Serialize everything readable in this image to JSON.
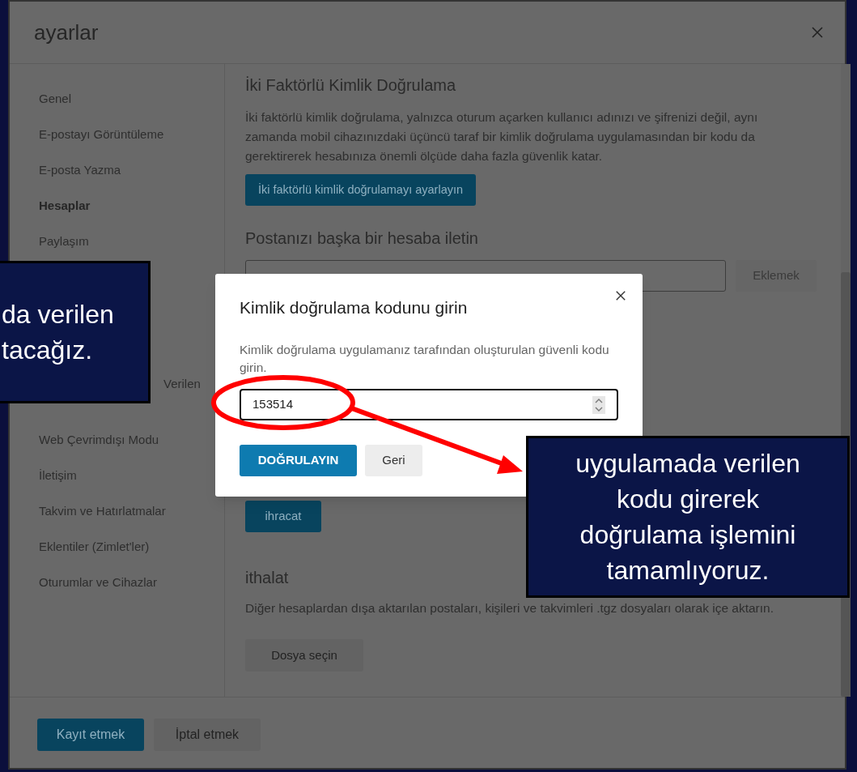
{
  "window": {
    "title": "ayarlar"
  },
  "sidebar": {
    "items": [
      {
        "label": "Genel",
        "selected": false
      },
      {
        "label": "E-postayı Görüntüleme",
        "selected": false
      },
      {
        "label": "E-posta Yazma",
        "selected": false
      },
      {
        "label": "Hesaplar",
        "selected": true
      },
      {
        "label": "Paylaşım",
        "selected": false
      }
    ],
    "more_items": [
      {
        "label": "Verilen",
        "selected": false,
        "kind": "cut"
      },
      {
        "label": "Web Çevrimdışı Modu",
        "selected": false,
        "kind": "full"
      },
      {
        "label": "İletişim",
        "selected": false,
        "kind": "full"
      },
      {
        "label": "Takvim ve Hatırlatmalar",
        "selected": false,
        "kind": "full"
      },
      {
        "label": "Eklentiler (Zimlet'ler)",
        "selected": false,
        "kind": "full"
      },
      {
        "label": "Oturumlar ve Cihazlar",
        "selected": false,
        "kind": "full"
      }
    ]
  },
  "two_factor": {
    "heading": "İki Faktörlü Kimlik Doğrulama",
    "text": "İki faktörlü kimlik doğrulama, yalnızca oturum açarken kullanıcı adınızı ve şifrenizi değil, aynı zamanda mobil cihazınızdaki üçüncü taraf bir kimlik doğrulama uygulamasından bir kodu da gerektirerek hesabınıza önemli ölçüde daha fazla güvenlik katar.",
    "button": "İki faktörlü kimlik doğrulamayı ayarlayın"
  },
  "forwarding": {
    "heading": "Postanızı başka bir hesaba iletin",
    "add_button": {
      "label": "Eklemek",
      "disabled": true
    }
  },
  "export": {
    "button": "ihracat"
  },
  "import": {
    "heading": "ithalat",
    "text": "Diğer hesaplardan dışa aktarılan postaları, kişileri ve takvimleri .tgz dosyaları olarak içe aktarın.",
    "button": "Dosya seçin"
  },
  "footer": {
    "buttons": [
      {
        "label": "Kayıt etmek",
        "kind": "primary"
      },
      {
        "label": "İptal etmek",
        "kind": "secondary"
      }
    ]
  },
  "dialog": {
    "title": "Kimlik doğrulama kodunu girin",
    "text": "Kimlik doğrulama uygulamanız tarafından oluşturulan güvenli kodu girin.",
    "field": {
      "value": "153514"
    },
    "buttons": [
      {
        "label": "DOĞRULAYIN",
        "kind": "primary"
      },
      {
        "label": "Geri",
        "kind": "secondary"
      }
    ]
  },
  "callouts": [
    {
      "lines": [
        "da verilen",
        "tacağız."
      ],
      "kind": "left"
    },
    {
      "lines": [
        "uygulamada verilen",
        "kodu girerek",
        "doğrulama işlemini",
        "tamamlıyoruz."
      ],
      "kind": "right"
    }
  ]
}
